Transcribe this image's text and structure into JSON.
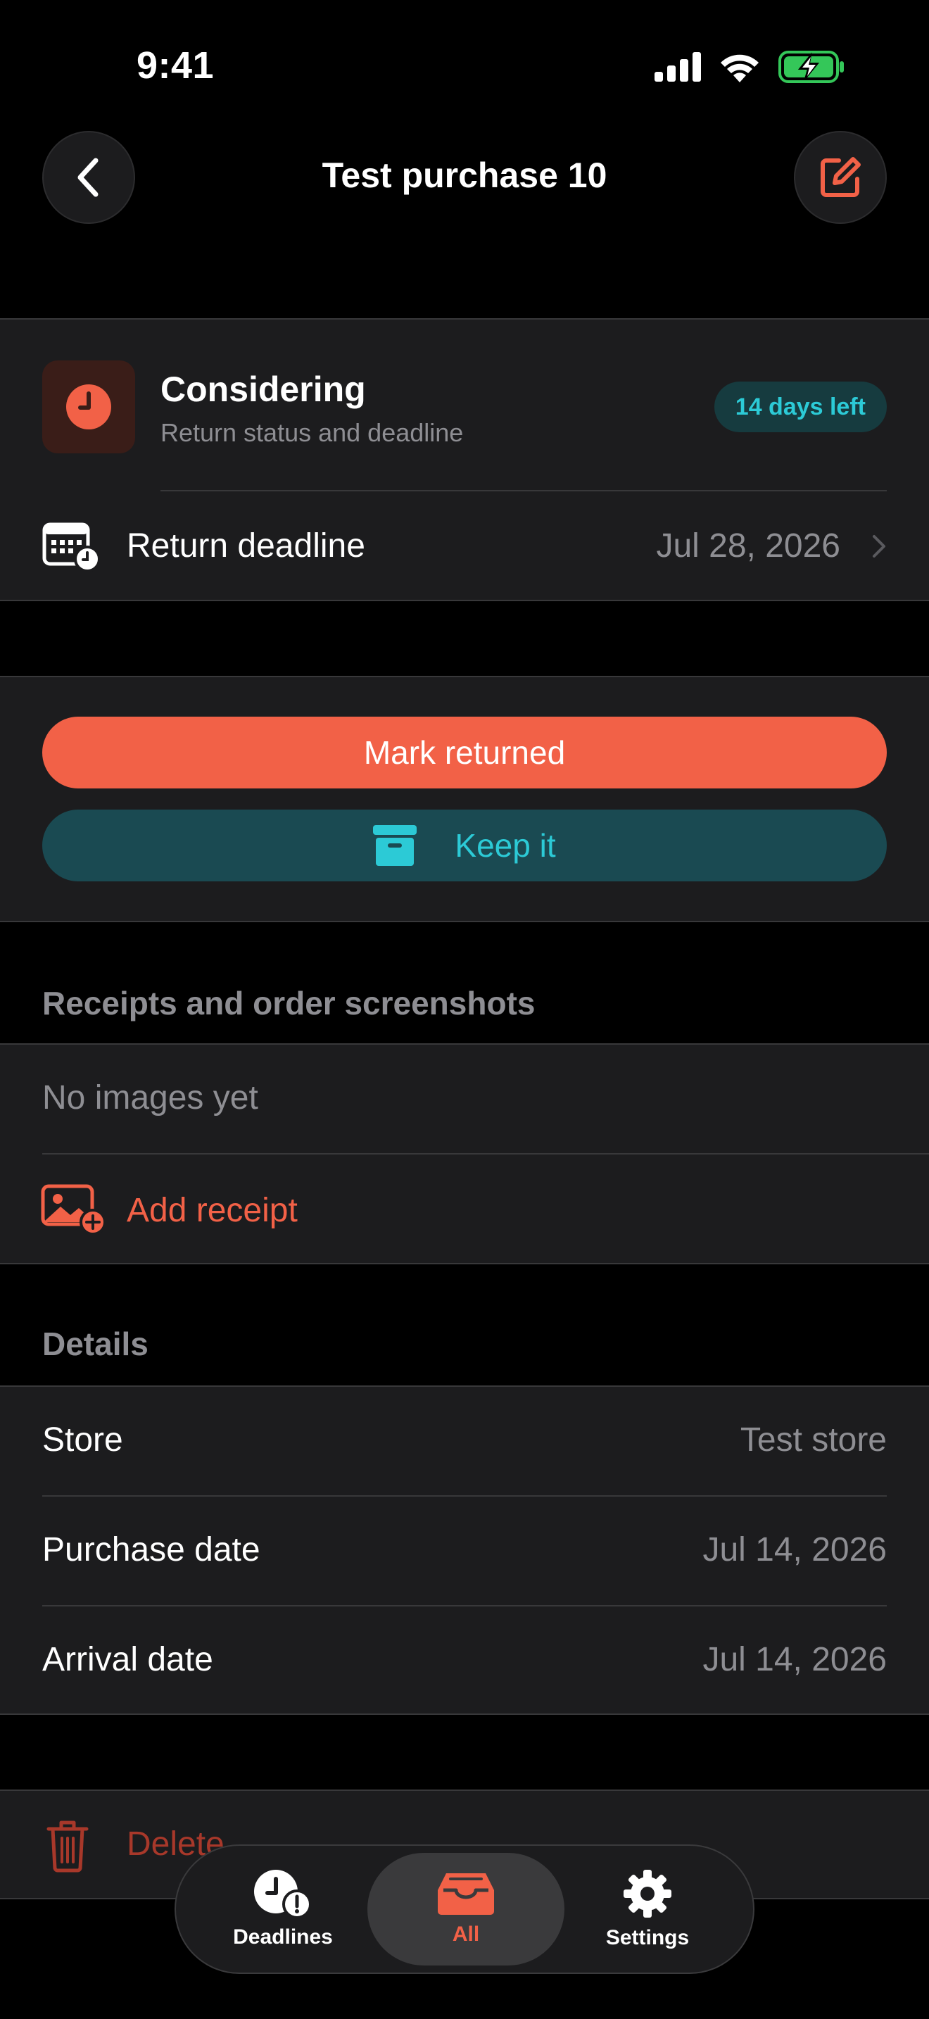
{
  "status_bar": {
    "time": "9:41"
  },
  "nav": {
    "title": "Test purchase 10"
  },
  "status_card": {
    "title": "Considering",
    "subtitle": "Return status and deadline",
    "badge": "14 days left",
    "deadline_label": "Return deadline",
    "deadline_value": "Jul 28, 2026"
  },
  "actions": {
    "mark_returned": "Mark returned",
    "keep_it": "Keep it"
  },
  "receipts": {
    "header": "Receipts and order screenshots",
    "empty": "No images yet",
    "add": "Add receipt"
  },
  "details": {
    "header": "Details",
    "rows": [
      {
        "label": "Store",
        "value": "Test store"
      },
      {
        "label": "Purchase date",
        "value": "Jul 14, 2026"
      },
      {
        "label": "Arrival date",
        "value": "Jul 14, 2026"
      }
    ]
  },
  "delete_label": "Delete",
  "tabbar": {
    "tabs": [
      {
        "label": "Deadlines",
        "icon": "clock-alert-icon",
        "active": false
      },
      {
        "label": "All",
        "icon": "tray-icon",
        "active": true
      },
      {
        "label": "Settings",
        "icon": "gear-icon",
        "active": false
      }
    ]
  },
  "colors": {
    "accent": "#f26147",
    "teal": "#2ccad6",
    "background": "#000000",
    "card": "#1c1c1e",
    "secondary_text": "#8e8e93"
  }
}
